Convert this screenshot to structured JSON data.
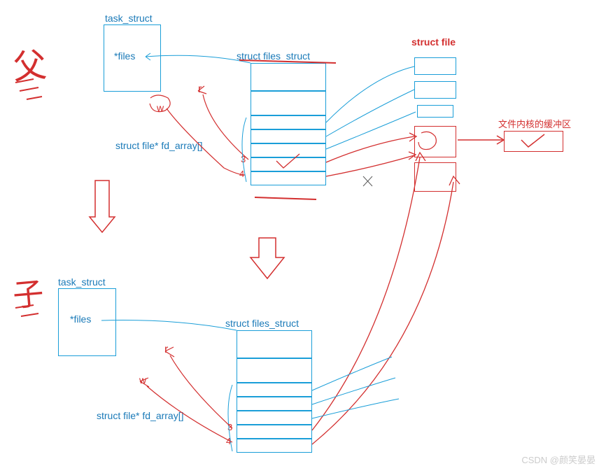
{
  "labels": {
    "task_struct_top": "task_struct",
    "files_ptr_top": "*files",
    "files_struct_top": "struct files_struct",
    "struct_file": "struct file",
    "buffer_label": "文件内核的缓冲区",
    "fd_array_top": "struct file* fd_array[]",
    "task_struct_bottom": "task_struct",
    "files_ptr_bottom": "*files",
    "files_struct_bottom": "struct files_struct",
    "fd_array_bottom": "struct file* fd_array[]",
    "r_top": "r",
    "w_top": "w",
    "three_top": "3",
    "four_top": "4",
    "r_bottom": "r",
    "w_bottom": "w",
    "three_bottom": "3",
    "four_bottom": "4",
    "handwritten_parent": "父",
    "handwritten_child": "子"
  },
  "watermark": "CSDN @颜笑晏晏"
}
